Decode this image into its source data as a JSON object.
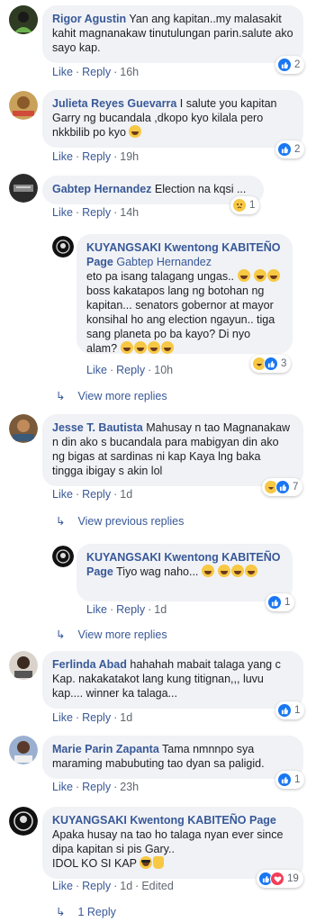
{
  "comments": [
    {
      "author": "Rigor Agustin",
      "text": "Yan ang kapitan..my malasakit kahit magnanakaw tinutulungan parin.salute ako sayo kap.",
      "like_label": "Like",
      "reply_label": "Reply",
      "time": "16h",
      "reaction_count": "2"
    },
    {
      "author": "Julieta Reyes Guevarra",
      "text": "I salute you kapitan Garry ng bucandala ,dkopo kyo kilala pero nkkbilib po kyo",
      "like_label": "Like",
      "reply_label": "Reply",
      "time": "19h",
      "reaction_count": "2"
    },
    {
      "author": "Gabtep Hernandez",
      "text": "Election na kqsi ...",
      "like_label": "Like",
      "reply_label": "Reply",
      "time": "14h",
      "reaction_count": "1"
    },
    {
      "author": "KUYANGSAKI Kwentong KABITEÑO Page",
      "mention": "Gabtep Hernandez",
      "text": "eto pa isang talagang ungas..",
      "text2": "boss kakatapos lang ng botohan ng kapitan... senators gobernor at mayor konsihal ho ang election ngayun.. tiga sang planeta po ba kayo? Di nyo alam?",
      "like_label": "Like",
      "reply_label": "Reply",
      "time": "10h",
      "reaction_count": "3"
    },
    {
      "author": "Jesse T. Bautista",
      "text": "Mahusay n tao Magnanakaw n din ako s bucandala para mabigyan din ako ng bigas at sardinas ni kap Kaya lng baka tingga ibigay s akin lol",
      "like_label": "Like",
      "reply_label": "Reply",
      "time": "1d",
      "reaction_count": "7"
    },
    {
      "author": "KUYANGSAKI Kwentong KABITEÑO Page",
      "text": "Tiyo wag naho...",
      "like_label": "Like",
      "reply_label": "Reply",
      "time": "1d",
      "reaction_count": "1"
    },
    {
      "author": "Ferlinda Abad",
      "text": "hahahah mabait talaga yang c Kap. nakakatakot lang kung titignan,,, luvu kap.... winner ka talaga...",
      "like_label": "Like",
      "reply_label": "Reply",
      "time": "1d",
      "reaction_count": "1"
    },
    {
      "author": "Marie Parin Zapanta",
      "text": "Tama nmnnpo sya maraming mabubuting tao dyan sa paligid.",
      "like_label": "Like",
      "reply_label": "Reply",
      "time": "23h",
      "reaction_count": "1"
    },
    {
      "author": "KUYANGSAKI Kwentong KABITEÑO Page",
      "text": "Apaka husay na tao ho talaga nyan ever since dipa kapitan si pis Gary..",
      "text2": "IDOL KO SI KAP",
      "like_label": "Like",
      "reply_label": "Reply",
      "time": "1d",
      "edited": "Edited",
      "reaction_count": "19"
    }
  ],
  "view_more_replies": "View more replies",
  "view_previous_replies": "View previous replies",
  "view_more_replies_2": "View more replies",
  "one_reply": "1 Reply",
  "colors": {
    "link": "#385898",
    "bubble": "#f0f2f5",
    "like_blue": "#1877f2",
    "meta": "#606770"
  }
}
